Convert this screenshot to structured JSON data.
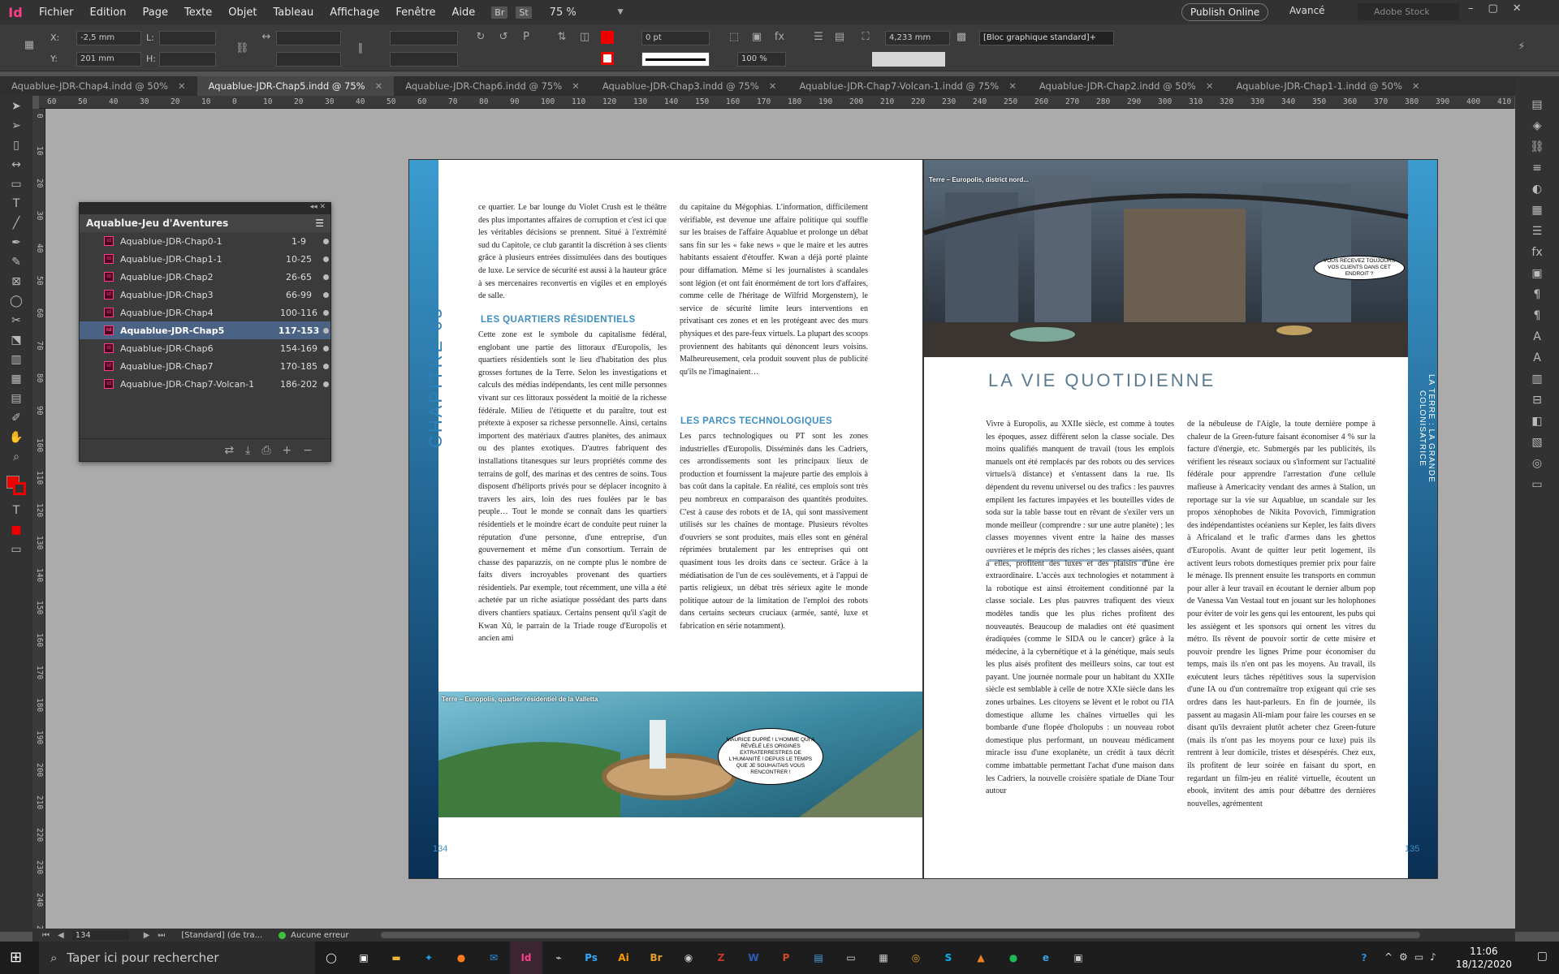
{
  "menubar": {
    "logo": "Id",
    "items": [
      "Fichier",
      "Edition",
      "Page",
      "Texte",
      "Objet",
      "Tableau",
      "Affichage",
      "Fenêtre",
      "Aide"
    ],
    "badges": [
      "Br",
      "St"
    ],
    "zoom": "75 %",
    "publish": "Publish Online",
    "workspace": "Avancé",
    "stock_placeholder": "Adobe Stock"
  },
  "control": {
    "x_label": "X:",
    "x_value": "-2,5 mm",
    "y_label": "Y:",
    "y_value": "201 mm",
    "w_label": "L:",
    "h_label": "H:",
    "stroke_weight": "0 pt",
    "scale": "100 %",
    "dimension": "4,233 mm",
    "object_style": "[Bloc graphique standard]+"
  },
  "tabs": [
    {
      "label": "Aquablue-JDR-Chap4.indd @ 50%",
      "active": false
    },
    {
      "label": "Aquablue-JDR-Chap5.indd @ 75%",
      "active": true
    },
    {
      "label": "Aquablue-JDR-Chap6.indd @ 75%",
      "active": false
    },
    {
      "label": "Aquablue-JDR-Chap3.indd @ 75%",
      "active": false
    },
    {
      "label": "Aquablue-JDR-Chap7-Volcan-1.indd @ 75%",
      "active": false
    },
    {
      "label": "Aquablue-JDR-Chap2.indd @ 50%",
      "active": false
    },
    {
      "label": "Aquablue-JDR-Chap1-1.indd @ 50%",
      "active": false
    }
  ],
  "ruler": [
    "60",
    "50",
    "40",
    "30",
    "20",
    "10",
    "0",
    "10",
    "20",
    "30",
    "40",
    "50",
    "60",
    "70",
    "80",
    "90",
    "100",
    "110",
    "120",
    "130",
    "140",
    "150",
    "160",
    "170",
    "180",
    "190",
    "200",
    "210",
    "220",
    "230",
    "240",
    "250",
    "260",
    "270",
    "280",
    "290",
    "300",
    "310",
    "320",
    "330",
    "340",
    "350",
    "360",
    "370",
    "380",
    "390",
    "400",
    "410"
  ],
  "book": {
    "title": "Aquablue-Jeu d'Aventures",
    "rows": [
      {
        "name": "Aquablue-JDR-Chap0-1",
        "pages": "1-9",
        "selected": false
      },
      {
        "name": "Aquablue-JDR-Chap1-1",
        "pages": "10-25",
        "selected": false
      },
      {
        "name": "Aquablue-JDR-Chap2",
        "pages": "26-65",
        "selected": false
      },
      {
        "name": "Aquablue-JDR-Chap3",
        "pages": "66-99",
        "selected": false
      },
      {
        "name": "Aquablue-JDR-Chap4",
        "pages": "100-116",
        "selected": false
      },
      {
        "name": "Aquablue-JDR-Chap5",
        "pages": "117-153",
        "selected": true
      },
      {
        "name": "Aquablue-JDR-Chap6",
        "pages": "154-169",
        "selected": false
      },
      {
        "name": "Aquablue-JDR-Chap7",
        "pages": "170-185",
        "selected": false
      },
      {
        "name": "Aquablue-JDR-Chap7-Volcan-1",
        "pages": "186-202",
        "selected": false
      }
    ]
  },
  "page_left": {
    "chapter": "CHAPITRE 05",
    "number": "134",
    "col1_a": "ce quartier. Le bar lounge du Violet Crush est le théâtre des plus importantes affaires de corruption et c'est ici que les véritables décisions se prennent. Situé à l'extrémité sud du Capitole, ce club garantit la discrétion à ses clients grâce à plusieurs entrées dissimulées dans des boutiques de luxe. Le service de sécurité est aussi à la hauteur grâce à ses mercenaires reconvertis en vigiles et en employés de salle.",
    "h_residentiels": "LES QUARTIERS RÉSIDENTIELS",
    "col1_b": "Cette zone est le symbole du capitalisme fédéral, englobant une partie des littoraux d'Europolis, les quartiers résidentiels sont le lieu d'habitation des plus grosses fortunes de la Terre. Selon les investigations et calculs des médias indépendants, les cent mille personnes vivant sur ces littoraux possèdent la moitié de la richesse fédérale. Milieu de l'étiquette et du paraître, tout est prétexte à exposer sa richesse personnelle. Ainsi, certains importent des matériaux d'autres planètes, des animaux ou des plantes exotiques. D'autres fabriquent des installations titanesques sur leurs propriétés comme des terrains de golf, des marinas et des centres de soins. Tous disposent d'héliports privés pour se déplacer incognito à travers les airs, loin des rues foulées par le bas peuple… Tout le monde se connaît dans les quartiers résidentiels et le moindre écart de conduite peut ruiner la réputation d'une personne, d'une entreprise, d'un gouvernement et même d'un consortium. Terrain de chasse des paparazzis, on ne compte plus le nombre de faits divers incroyables provenant des quartiers résidentiels. Par exemple, tout récemment, une villa a été achetée par un riche asiatique possédant des parts dans divers chantiers spatiaux. Certains pensent qu'il s'agit de Kwan Xû, le parrain de la Triade rouge d'Europolis et ancien ami",
    "col2_a": "du capitaine du Mégophias. L'information, difficilement vérifiable, est devenue une affaire politique qui souffle sur les braises de l'affaire Aquablue et prolonge un débat sans fin sur les « fake news » que le maire et les autres habitants essaient d'étouffer. Kwan a déjà porté plainte pour diffamation. Même si les journalistes à scandales sont légion (et ont fait énormément de tort lors d'affaires, comme celle de l'héritage de Wilfrid Morgenstern), le service de sécurité limite leurs interventions en privatisant ces zones et en les protégeant avec des murs physiques et des pare-feux virtuels. La plupart des scoops proviennent des habitants qui dénoncent leurs voisins. Malheureusement, cela produit souvent plus de publicité qu'ils ne l'imaginaient…",
    "h_parcs": "LES PARCS TECHNOLOGIQUES",
    "col2_b": "Les parcs technologiques ou PT sont les zones industrielles d'Europolis. Disséminés dans les Cadriers, ces arrondissements sont les principaux lieux de production et fournissent la majeure partie des emplois à bas coût dans la capitale. En réalité, ces emplois sont très peu nombreux en comparaison des quantités produites. C'est à cause des robots et de IA, qui sont massivement utilisés sur les chaînes de montage. Plusieurs révoltes d'ouvriers se sont produites, mais elles sont en général réprimées brutalement par les entreprises qui ont quasiment tous les droits dans ce secteur. Grâce à la médiatisation de l'un de ces soulèvements, et à l'appui de partis religieux, un débat très sérieux agite le monde politique autour de la limitation de l'emploi des robots dans certains secteurs cruciaux (armée, santé, luxe et fabrication en série notamment).",
    "img_caption": "Terre – Europolis, quartier résidentiel de la Valletta",
    "img_bubble": "MAURICE DUPRÉ ! L'HOMME QUI A RÉVÉLÉ LES ORIGINES EXTRATERRESTRES DE L'HUMANITÉ ! DEPUIS LE TEMPS QUE JE SOUHAITAIS VOUS RENCONTRER !"
  },
  "page_right": {
    "side_title": "LA TERRE : LA GRANDE COLONISATRICE",
    "number": "135",
    "img_caption": "Terre – Europolis, district nord...",
    "img_bubble": "VOUS RECEVEZ TOUJOURS VOS CLIENTS DANS CET ENDROIT ?",
    "title": "LA VIE QUOTIDIENNE",
    "col1": "Vivre à Europolis, au XXIIe siècle, est comme à toutes les époques, assez différent selon la classe sociale. Des moins qualifiés manquent de travail (tous les emplois manuels ont été remplacés par des robots ou des services virtuels/à distance) et s'entassent dans la rue. Ils dépendent du revenu universel ou des trafics : les pauvres empilent les factures impayées et les bouteilles vides de soda sur la table basse tout en rêvant de s'exiler vers un monde meilleur (comprendre : sur une autre planète) ; les classes moyennes vivent entre la haine des masses ouvrières et le mépris des riches ; les classes aisées, quant à elles, profitent des luxes et des plaisirs d'une ère extraordinaire. L'accès aux technologies et notamment à la robotique est ainsi étroitement conditionné par la classe sociale. Les plus pauvres trafiquent des vieux modèles tandis que les plus riches profitent des nouveautés. Beaucoup de maladies ont été quasiment éradiquées (comme le SIDA ou le cancer) grâce à la médecine, à la cybernétique et à la génétique, mais seuls les plus aisés profitent des meilleurs soins, car tout est payant. Une journée normale pour un habitant du XXIIe siècle est semblable à celle de notre XXIe siècle dans les zones urbaines. Les citoyens se lèvent et le robot ou l'IA domestique allume les chaînes virtuelles qui les bombarde d'une flopée d'holopubs : un nouveau robot domestique plus performant, un nouveau médicament miracle issu d'une exoplanète, un crédit à taux décrit comme imbattable permettant l'achat d'une maison dans les Cadriers, la nouvelle croisière spatiale de Diane Tour autour",
    "col2": "de la nébuleuse de l'Aigle, la toute dernière pompe à chaleur de la Green-future faisant économiser 4 % sur la facture d'énergie, etc. Submergés par les publicités, ils vérifient les réseaux sociaux ou s'informent sur l'actualité fédérale pour apprendre l'arrestation d'une cellule mafieuse à Americacity vendant des armes à Stalion, un reportage sur la vie sur Aquablue, un scandale sur les propos xénophobes de Nikita Povovich, l'immigration des indépendantistes océaniens sur Kepler, les faits divers à Africaland et le trafic d'armes dans les ghettos d'Europolis. Avant de quitter leur petit logement, ils activent leurs robots domestiques premier prix pour faire le ménage. Ils prennent ensuite les transports en commun pour aller à leur travail en écoutant le dernier album pop de Vanessa Van Vestaal tout en jouant sur les holophones pour éviter de voir les gens qui les entourent, les pubs qui les assiègent et les sponsors qui ornent les vitres du métro. Ils rêvent de pouvoir sortir de cette misère et pouvoir prendre les lignes Prime pour économiser du temps, mais ils n'en ont pas les moyens. Au travail, ils exécutent leurs tâches répétitives sous la supervision d'une IA ou d'un contremaître trop exigeant qui crie ses ordres dans les haut-parleurs. En fin de journée, ils passent au magasin Ali-miam pour faire les courses en se disant qu'ils devraient plutôt acheter chez Green-future (mais ils n'ont pas les moyens pour ce luxe) puis ils rentrent à leur domicile, tristes et désespérés. Chez eux, ils profitent de leur soirée en faisant du sport, en regardant un film-jeu en réalité virtuelle, écoutent un ebook, invitent des amis pour débattre des dernières nouvelles, agrémentent"
  },
  "status": {
    "page": "134",
    "master": "[Standard] (de tra...",
    "preflight": "Aucune erreur"
  },
  "taskbar": {
    "search_placeholder": "Taper ici pour rechercher",
    "apps": [
      "Id",
      "Ps",
      "Ai",
      "Br",
      "W",
      "P"
    ],
    "time": "11:06",
    "date": "18/12/2020"
  }
}
